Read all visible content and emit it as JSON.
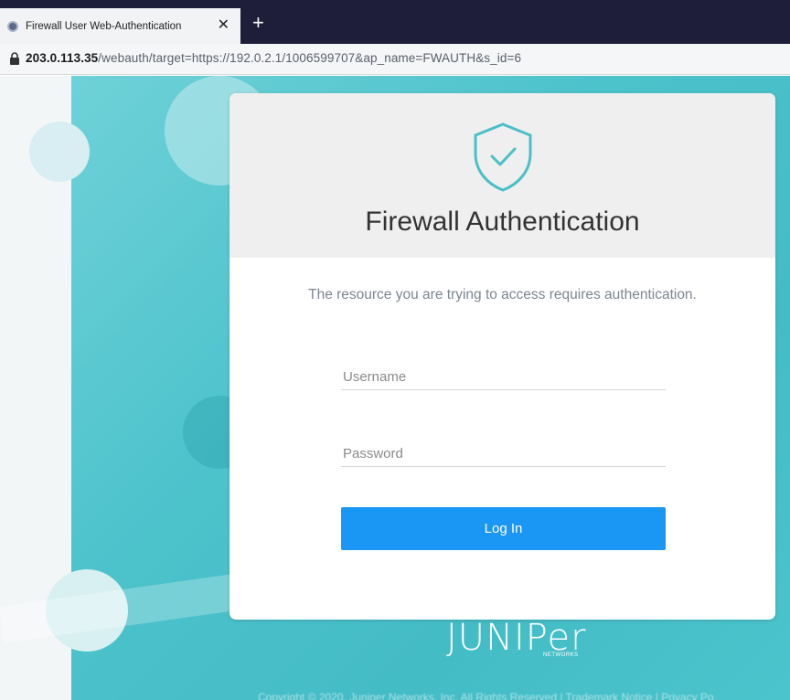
{
  "browser": {
    "tab_title": "Firewall User Web-Authentication",
    "new_tab_label": "+",
    "close_label": "✕",
    "url_host": "203.0.113.35",
    "url_path": "/webauth/target=https://192.0.2.1/1006599707&ap_name=FWAUTH&s_id=6"
  },
  "card": {
    "title": "Firewall Authentication",
    "subtitle": "The resource you are trying to access requires authentication.",
    "username_placeholder": "Username",
    "password_placeholder": "Password",
    "login_label": "Log In",
    "icon": "shield-check-icon"
  },
  "brand": {
    "logo_text": "JUNIPer",
    "logo_subtext": "NETWORKS",
    "footer_text": "Copyright © 2020, Juniper Networks, Inc. All Rights Reserved | Trademark Notice | Privacy Po"
  },
  "colors": {
    "accent": "#1a97f5",
    "background_teal": "#4cc2cb",
    "shield": "#4bbfc8"
  }
}
